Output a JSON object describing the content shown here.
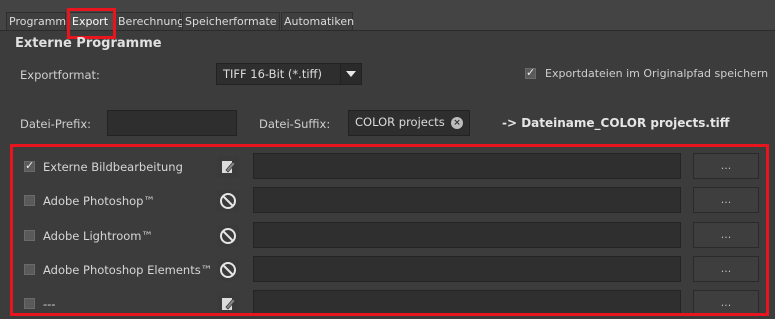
{
  "tabs": [
    {
      "label": "Programm"
    },
    {
      "label": "Export"
    },
    {
      "label": "Berechnung"
    },
    {
      "label": "Speicherformate"
    },
    {
      "label": "Automatiken"
    }
  ],
  "section_title": "Externe Programme",
  "exportformat": {
    "label": "Exportformat:",
    "value": "TIFF 16-Bit (*.tiff)"
  },
  "original_path": {
    "label": "Exportdateien im Originalpfad speichern",
    "checked": true
  },
  "prefix": {
    "label": "Datei-Prefix:",
    "value": ""
  },
  "suffix": {
    "label": "Datei-Suffix:",
    "value": "COLOR projects"
  },
  "result_name": "-> Dateiname_COLOR projects.tiff",
  "programs": [
    {
      "label": "Externe Bildbearbeitung",
      "checked": true,
      "icon": "edit-icon",
      "path": "",
      "browse": "..."
    },
    {
      "label": "Adobe Photoshop™",
      "checked": false,
      "icon": "not-available-icon",
      "path": "",
      "browse": "..."
    },
    {
      "label": "Adobe Lightroom™",
      "checked": false,
      "icon": "not-available-icon",
      "path": "",
      "browse": "..."
    },
    {
      "label": "Adobe Photoshop Elements™",
      "checked": false,
      "icon": "not-available-icon",
      "path": "",
      "browse": "..."
    },
    {
      "label": "---",
      "checked": false,
      "icon": "edit-icon",
      "path": "",
      "browse": "..."
    }
  ],
  "colors": {
    "highlight": "#e8141e",
    "background": "#3c3c3c"
  }
}
